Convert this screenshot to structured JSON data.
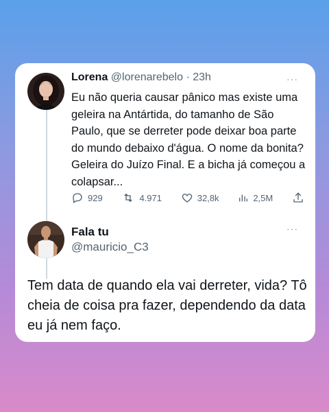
{
  "tweet1": {
    "name": "Lorena",
    "handle": "@lorenarebelo",
    "separator": "·",
    "time": "23h",
    "text": "Eu não queria causar pânico mas existe uma geleira na Antártida, do tamanho de São Paulo, que se derreter pode deixar boa parte do mundo debaixo d'água. O nome da bonita? Geleira do Juízo Final. E a bicha já começou a colapsar...",
    "replies": "929",
    "retweets": "4.971",
    "likes": "32,8k",
    "views": "2,5M",
    "more": "···"
  },
  "tweet2": {
    "name": "Fala tu",
    "handle": "@mauricio_C3",
    "text": "Tem data de quando ela vai derreter, vida? Tô cheia de coisa pra fazer, dependendo da data eu já nem faço.",
    "more": "···"
  },
  "icons": {
    "reply": "reply-icon",
    "retweet": "retweet-icon",
    "like": "heart-icon",
    "views": "views-icon",
    "share": "share-icon"
  },
  "colors": {
    "text": "#0f1419",
    "secondary": "#536471",
    "thread_line": "#cfd9de"
  }
}
